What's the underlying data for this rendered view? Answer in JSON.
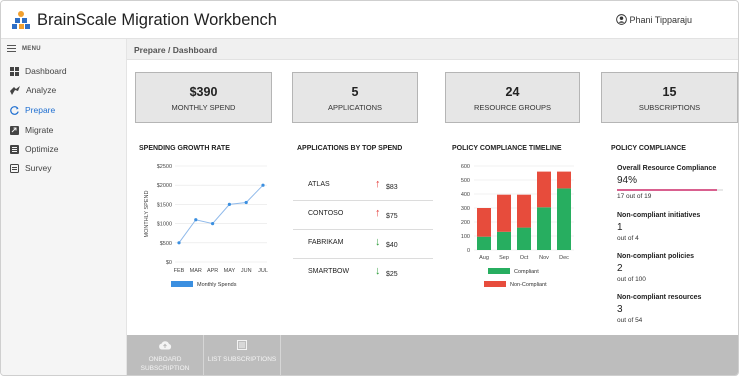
{
  "header": {
    "title": "BrainScale Migration Workbench",
    "user_name": "Phani Tipparaju"
  },
  "sidebar": {
    "menu_label": "MENU",
    "items": [
      {
        "label": "Dashboard",
        "icon": "dashboard-icon"
      },
      {
        "label": "Analyze",
        "icon": "analyze-icon"
      },
      {
        "label": "Prepare",
        "icon": "prepare-icon",
        "active": true
      },
      {
        "label": "Migrate",
        "icon": "migrate-icon"
      },
      {
        "label": "Optimize",
        "icon": "optimize-icon"
      },
      {
        "label": "Survey",
        "icon": "survey-icon"
      }
    ]
  },
  "breadcrumb": "Prepare / Dashboard",
  "kpis": [
    {
      "value": "$390",
      "label": "MONTHLY SPEND"
    },
    {
      "value": "5",
      "label": "APPLICATIONS"
    },
    {
      "value": "24",
      "label": "RESOURCE GROUPS"
    },
    {
      "value": "15",
      "label": "SUBSCRIPTIONS"
    }
  ],
  "panels": {
    "spending": "SPENDING GROWTH RATE",
    "apps": "APPLICATIONS BY TOP SPEND",
    "timeline": "POLICY COMPLIANCE TIMELINE",
    "policy": "POLICY COMPLIANCE"
  },
  "top_spend": [
    {
      "name": "ATLAS",
      "amount": "$83",
      "trend": "up"
    },
    {
      "name": "CONTOSO",
      "amount": "$75",
      "trend": "up"
    },
    {
      "name": "FABRIKAM",
      "amount": "$40",
      "trend": "down"
    },
    {
      "name": "SMARTBOW",
      "amount": "$25",
      "trend": "down"
    }
  ],
  "policy_compliance": {
    "overall": {
      "label": "Overall Resource Compliance",
      "value": "94%",
      "sub": "17 out of 19",
      "fraction": 0.94
    },
    "initiatives": {
      "label": "Non-compliant initiatives",
      "value": "1",
      "sub": "out of 4"
    },
    "policies": {
      "label": "Non-compliant policies",
      "value": "2",
      "sub": "out of 100"
    },
    "resources": {
      "label": "Non-compliant resources",
      "value": "3",
      "sub": "out of 54"
    }
  },
  "actions": [
    {
      "label_line1": "ONBOARD",
      "label_line2": "SUBSCRIPTION",
      "icon": "cloud-upload-icon"
    },
    {
      "label_line1": "LIST SUBSCRIPTIONS",
      "label_line2": "",
      "icon": "list-icon"
    }
  ],
  "colors": {
    "accent": "#1f6fd1",
    "line": "#8fb9ea",
    "legend_blue": "#3b8fe0",
    "compliant": "#27ae60",
    "non_compliant": "#e74c3c",
    "progress": "#d9608f",
    "up_arrow": "#e53935",
    "down_arrow": "#2e9d3a",
    "logo_blue": "#2e6fc6",
    "logo_orange": "#f0a030"
  },
  "chart_data": [
    {
      "type": "line",
      "title": "SPENDING GROWTH RATE",
      "xlabel": "",
      "ylabel": "MONTHLY SPEND",
      "categories": [
        "FEB",
        "MAR",
        "APR",
        "MAY",
        "JUN",
        "JUL"
      ],
      "series": [
        {
          "name": "Monthly Spends",
          "values": [
            500,
            1100,
            1000,
            1500,
            1550,
            2000
          ]
        }
      ],
      "ylim": [
        0,
        2500
      ],
      "yticks": [
        "$0",
        "$500",
        "$1000",
        "$1500",
        "$2000",
        "$2500"
      ],
      "grid": true,
      "legend": "bottom"
    },
    {
      "type": "bar",
      "stacked": true,
      "title": "POLICY COMPLIANCE TIMELINE",
      "categories": [
        "Aug",
        "Sep",
        "Oct",
        "Nov",
        "Dec"
      ],
      "series": [
        {
          "name": "Compliant",
          "values": [
            95,
            130,
            160,
            305,
            440
          ]
        },
        {
          "name": "Non-Compliant",
          "values": [
            205,
            265,
            235,
            255,
            120
          ]
        }
      ],
      "ylim": [
        0,
        600
      ],
      "yticks": [
        "0",
        "100",
        "200",
        "300",
        "400",
        "500",
        "600"
      ],
      "grid": true,
      "legend": "bottom"
    }
  ]
}
